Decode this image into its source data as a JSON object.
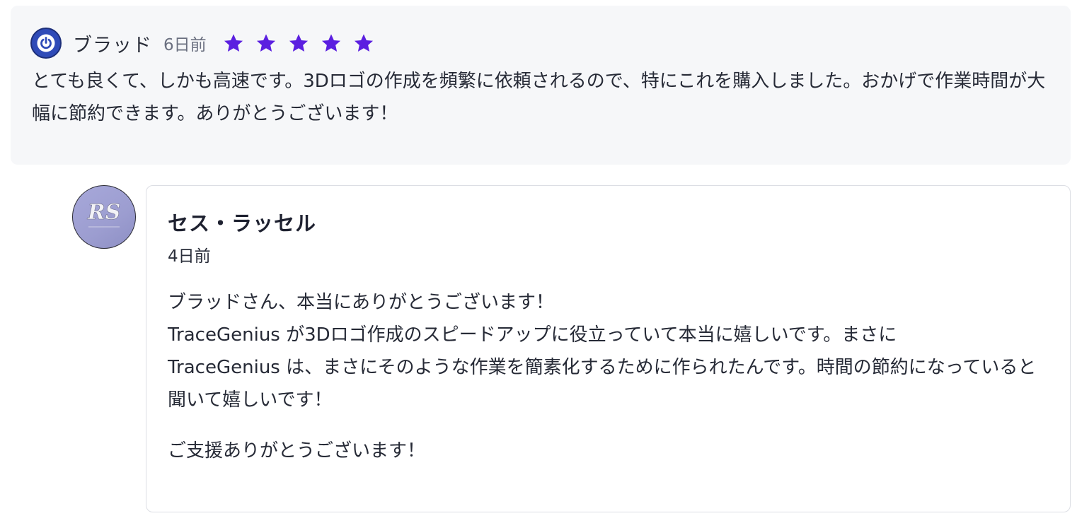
{
  "review": {
    "author": "ブラッド",
    "time_ago": "6日前",
    "rating": 5,
    "star_color": "#5b1fe0",
    "avatar_icon": "power-icon",
    "text": "とても良くて、しかも高速です。3Dロゴの作成を頻繁に依頼されるので、特にこれを購入しました。おかげで作業時間が大幅に節約できます。ありがとうございます！"
  },
  "reply": {
    "author": "セス・ラッセル",
    "time_ago": "4日前",
    "avatar_logo": "RS",
    "paragraphs": [
      "ブラッドさん、本当にありがとうございます！",
      "TraceGenius が3Dロゴ作成のスピードアップに役立っていて本当に嬉しいです。まさに",
      "TraceGenius は、まさにそのような作業を簡素化するために作られたんです。時間の節約になっていると聞いて嬉しいです！"
    ],
    "closing": "ご支援ありがとうございます！"
  }
}
